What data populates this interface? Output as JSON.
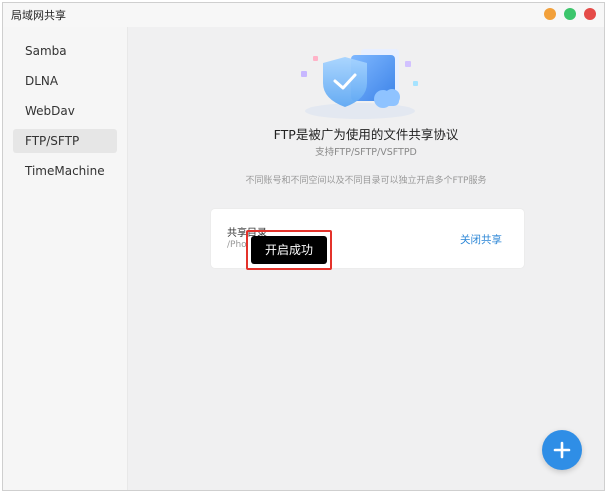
{
  "window": {
    "title": "局域网共享",
    "controls": {
      "minimize_color": "#f2a03a",
      "maximize_color": "#3cc56b",
      "close_color": "#e54b48"
    }
  },
  "sidebar": {
    "items": [
      {
        "label": "Samba"
      },
      {
        "label": "DLNA"
      },
      {
        "label": "WebDav"
      },
      {
        "label": "FTP/SFTP",
        "active": true
      },
      {
        "label": "TimeMachine"
      }
    ]
  },
  "main": {
    "hero_icon": "shared-folder-illustration",
    "headline": "FTP是被广为使用的文件共享协议",
    "subline": "支持FTP/SFTP/VSFTPD",
    "note": "不同账号和不同空间以及不同目录可以独立开启多个FTP服务",
    "card": {
      "label": "共享目录",
      "path": "/Pho",
      "action": "关闭共享"
    },
    "toast": "开启成功",
    "fab_icon": "plus-icon"
  },
  "colors": {
    "accent": "#2f8ee6",
    "link": "#2b86d6",
    "highlight": "#e4322b"
  }
}
